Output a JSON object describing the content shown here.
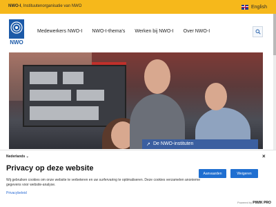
{
  "topbar": {
    "org_bold": "NWO-I",
    "org_rest": ", Instituutenorganisatie van NWO",
    "language_label": "English"
  },
  "header": {
    "logo_text": "NWO",
    "nav": [
      "Medewerkers NWO-I",
      "NWO-I-thema's",
      "Werken bij NWO-I",
      "Over NWO-I"
    ]
  },
  "hero": {
    "cta_label": "De NWO-instituten"
  },
  "cookie": {
    "language": "Nederlands",
    "close": "×",
    "title": "Privacy op deze website",
    "text": "Wij gebruiken cookies om onze website te verbeteren en uw surfervaring te optimaliseren. Deze cookies verzamelen anonieme gegevens voor website-analyse.",
    "privacy_link": "Privacybeleid",
    "accept_label": "Aanvaarden",
    "reject_label": "Weigeren",
    "powered_by": "Powered by",
    "brand": "PIWIK PRO"
  },
  "colors": {
    "topbar": "#f6b81b",
    "accent_blue": "#1f6fd1",
    "cta_blue": "#3b5fa0",
    "logo_blue": "#1c5aa8"
  },
  "icons": {
    "search": "search-icon",
    "flag": "uk-flag-icon",
    "arrow": "arrow-icon"
  }
}
